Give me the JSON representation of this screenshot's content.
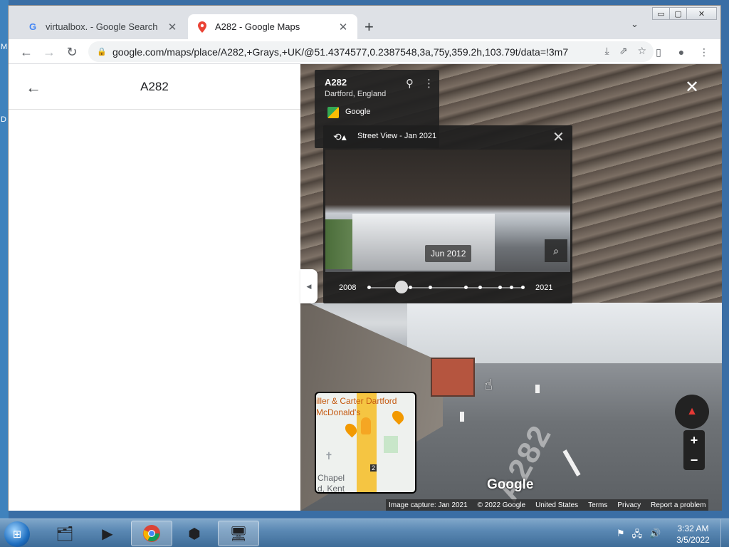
{
  "desktop": {
    "letters": [
      "M",
      "D"
    ]
  },
  "window_controls": {
    "minimize": "▭",
    "maximize": "▢",
    "close": "✕"
  },
  "tabs": [
    {
      "label": "virtualbox. - Google Search",
      "icon": "google-g-icon",
      "close": "✕"
    },
    {
      "label": "A282 - Google Maps",
      "icon": "maps-pin-icon",
      "close": "✕"
    }
  ],
  "new_tab": "+",
  "tab_menu": "⌄",
  "nav": {
    "back": "←",
    "forward": "→",
    "reload": "↻"
  },
  "omnibox": {
    "url": "google.com/maps/place/A282,+Grays,+UK/@51.4374577,0.2387548,3a,75y,359.2h,103.79t/data=!3m7!...",
    "icons": [
      "install-icon",
      "share-icon",
      "star-icon"
    ]
  },
  "toolbar_right": [
    "side-panel-icon",
    "profile-icon",
    "menu-icon"
  ],
  "left_panel": {
    "back": "←",
    "title": "A282",
    "collapse": "◀"
  },
  "street_view": {
    "place_title": "A282",
    "place_subtitle": "Dartford, England",
    "google_label": "Google",
    "close": "✕",
    "road_marking": "A282",
    "time_machine": {
      "header": "Street View - Jan 2021",
      "close": "✕",
      "preview_date": "Jun 2012",
      "start_year": "2008",
      "end_year": "2021",
      "zoom": "⌕"
    },
    "minimap": {
      "labels": [
        "iller & Carter Dartford",
        "McDonald's",
        "Chapel",
        "d, Kent"
      ],
      "road_number": "2"
    },
    "zoom_in": "+",
    "zoom_out": "−",
    "google_logo": "Google",
    "attribution": [
      "Image capture: Jan 2021",
      "© 2022 Google",
      "United States",
      "Terms",
      "Privacy",
      "Report a problem"
    ]
  },
  "taskbar": {
    "apps": [
      "file-explorer-icon",
      "media-player-icon",
      "chrome-icon",
      "virtualbox-icon",
      "network-app-icon"
    ],
    "clock_time": "3:32 AM",
    "clock_date": "3/5/2022"
  }
}
